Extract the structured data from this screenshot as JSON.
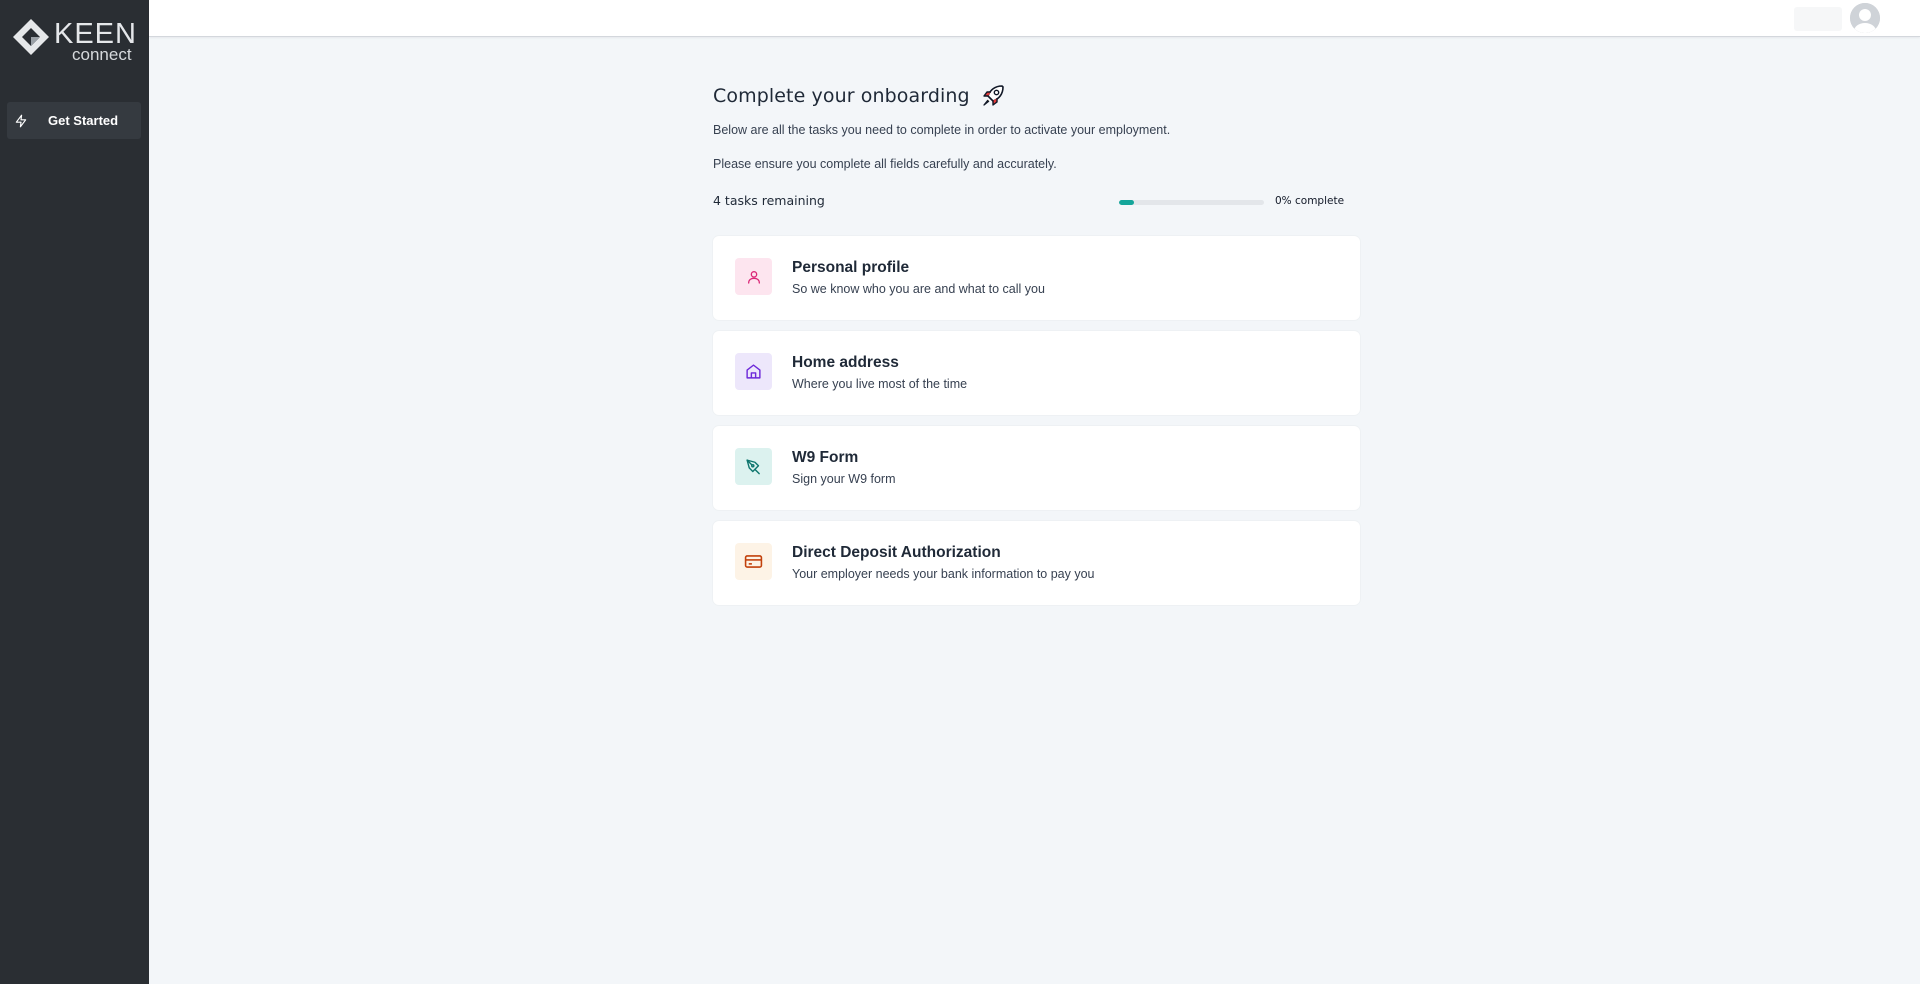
{
  "brand": {
    "name": "KEEN",
    "tagline": "connect"
  },
  "sidebar": {
    "items": [
      {
        "label": "Get Started",
        "icon": "lightning-icon",
        "active": true
      }
    ]
  },
  "onboarding": {
    "title": "Complete your onboarding",
    "title_icon": "rocket-icon",
    "intro": "Below are all the tasks you need to complete in order to activate your employment.",
    "instructions": "Please ensure you complete all fields carefully and accurately.",
    "tasks_remaining": "4 tasks remaining",
    "progress_label": "0% complete",
    "progress_fraction": 0.0
  },
  "tasks": [
    {
      "title": "Personal profile",
      "subtitle": "So we know who you are and what to call you",
      "icon": "user-icon",
      "icon_color": "#db2777",
      "icon_bg": "#fde5ef"
    },
    {
      "title": "Home address",
      "subtitle": "Where you live most of the time",
      "icon": "home-icon",
      "icon_color": "#6d28d9",
      "icon_bg": "#ede7fb"
    },
    {
      "title": "W9 Form",
      "subtitle": "Sign your W9 form",
      "icon": "pen-icon",
      "icon_color": "#0f766e",
      "icon_bg": "#dcf2ef"
    },
    {
      "title": "Direct Deposit Authorization",
      "subtitle": "Your employer needs your bank information to pay you",
      "icon": "credit-card-icon",
      "icon_color": "#c2410c",
      "icon_bg": "#fdf3e6"
    }
  ],
  "colors": {
    "sidebar_bg": "#2a2e33",
    "accent": "#14a59a",
    "page_bg": "#f3f6f9"
  }
}
